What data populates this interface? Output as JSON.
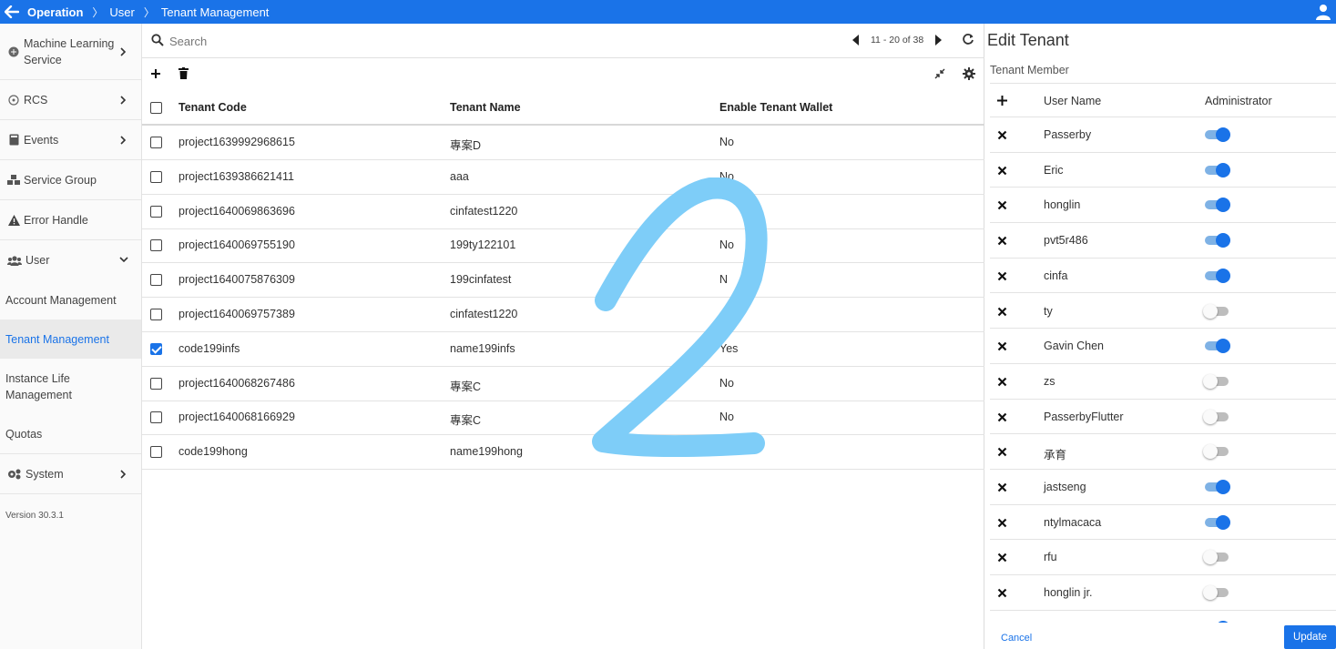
{
  "breadcrumb": {
    "root": "Operation",
    "level1": "User",
    "level2": "Tenant Management"
  },
  "sidebar": {
    "items": [
      {
        "label": "Machine Learning Service",
        "icon": "brain-icon"
      },
      {
        "label": "RCS",
        "icon": "satellite-icon"
      },
      {
        "label": "Events",
        "icon": "book-icon"
      },
      {
        "label": "Service Group",
        "icon": "cubes-icon"
      },
      {
        "label": "Error Handle",
        "icon": "warning-icon"
      },
      {
        "label": "User",
        "icon": "users-icon"
      }
    ],
    "sub_items": [
      "Account Management",
      "Tenant Management",
      "Instance Life Management",
      "Quotas"
    ],
    "system_label": "System",
    "version": "Version 30.3.1"
  },
  "search": {
    "placeholder": "Search",
    "value": ""
  },
  "pager": {
    "text": "11 - 20 of 38"
  },
  "table": {
    "headers": [
      "Tenant Code",
      "Tenant Name",
      "Enable Tenant Wallet"
    ],
    "rows": [
      {
        "code": "project1639992968615",
        "name": "專案D",
        "wallet": "No",
        "checked": false
      },
      {
        "code": "project1639386621411",
        "name": "aaa",
        "wallet": "No",
        "checked": false
      },
      {
        "code": "project1640069863696",
        "name": "cinfatest1220",
        "wallet": "",
        "checked": false
      },
      {
        "code": "project1640069755190",
        "name": "199ty122101",
        "wallet": "No",
        "checked": false
      },
      {
        "code": "project1640075876309",
        "name": "199cinfatest",
        "wallet": "N",
        "checked": false
      },
      {
        "code": "project1640069757389",
        "name": "cinfatest1220",
        "wallet": "",
        "checked": false
      },
      {
        "code": "code199infs",
        "name": "name199infs",
        "wallet": "Yes",
        "checked": true
      },
      {
        "code": "project1640068267486",
        "name": "專案C",
        "wallet": "No",
        "checked": false
      },
      {
        "code": "project1640068166929",
        "name": "專案C",
        "wallet": "No",
        "checked": false
      },
      {
        "code": "code199hong",
        "name": "name199hong",
        "wallet": "",
        "checked": false
      }
    ]
  },
  "panel": {
    "title": "Edit Tenant",
    "subtitle": "Tenant Member",
    "col_user": "User Name",
    "col_admin": "Administrator",
    "members": [
      {
        "name": "Passerby",
        "admin": true
      },
      {
        "name": "Eric",
        "admin": true
      },
      {
        "name": "honglin",
        "admin": true
      },
      {
        "name": "pvt5r486",
        "admin": true
      },
      {
        "name": "cinfa",
        "admin": true
      },
      {
        "name": "ty",
        "admin": false
      },
      {
        "name": "Gavin Chen",
        "admin": true
      },
      {
        "name": "zs",
        "admin": false
      },
      {
        "name": "PasserbyFlutter",
        "admin": false
      },
      {
        "name": "承育",
        "admin": false
      },
      {
        "name": "jastseng",
        "admin": true
      },
      {
        "name": "ntylmacaca",
        "admin": true
      },
      {
        "name": "rfu",
        "admin": false
      },
      {
        "name": "honglin jr.",
        "admin": false
      },
      {
        "name": "",
        "admin": true
      }
    ],
    "cancel_label": "Cancel",
    "update_label": "Update"
  },
  "colors": {
    "primary": "#1a73e8",
    "scribble": "#7ecdf8",
    "toggle_on_track": "#7fb2e5"
  }
}
